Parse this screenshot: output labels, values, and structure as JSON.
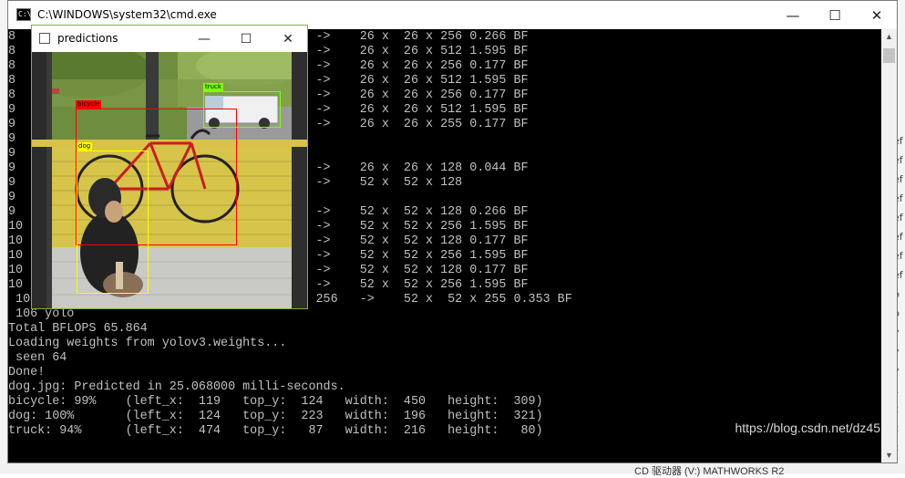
{
  "cmd_window": {
    "title": "C:\\WINDOWS\\system32\\cmd.exe",
    "icon_text": "C:\\",
    "minimize": "—",
    "maximize": "☐",
    "close": "✕"
  },
  "predictions_window": {
    "title": "predictions",
    "minimize": "—",
    "maximize": "☐",
    "close": "✕",
    "labels": {
      "bicycle": "bicycle",
      "truck": "truck",
      "dog": "dog"
    },
    "colors": {
      "bicycle": "#ff0000",
      "truck": "#80ff00",
      "dog": "#ffff00"
    }
  },
  "console": {
    "lines": [
      "8                                   768   ->    26 x  26 x 256 0.266 BF",
      "8                                   256   ->    26 x  26 x 512 1.595 BF",
      "8                                   512   ->    26 x  26 x 256 0.177 BF",
      "8                                   256   ->    26 x  26 x 512 1.595 BF",
      "8                                   512   ->    26 x  26 x 256 0.177 BF",
      "9                                   256   ->    26 x  26 x 512 1.595 BF",
      "9                                   512   ->    26 x  26 x 255 0.177 BF",
      "9",
      "9",
      "9                                   256   ->    26 x  26 x 128 0.044 BF",
      "9                                   128   ->    52 x  52 x 128",
      "9",
      "9                                   384   ->    52 x  52 x 128 0.266 BF",
      "10                                  128   ->    52 x  52 x 256 1.595 BF",
      "10                                  256   ->    52 x  52 x 128 0.177 BF",
      "10                                  128   ->    52 x  52 x 256 1.595 BF",
      "10                                  256   ->    52 x  52 x 128 0.177 BF",
      "10                                  128   ->    52 x  52 x 256 1.595 BF",
      " 105 conv    255  1 x 1 / 1    52 x  52 x 256   ->    52 x  52 x 255 0.353 BF",
      " 106 yolo",
      "Total BFLOPS 65.864",
      "Loading weights from yolov3.weights...",
      " seen 64",
      "Done!",
      "dog.jpg: Predicted in 25.068000 milli-seconds.",
      "bicycle: 99%    (left_x:  119   top_y:  124   width:  450   height:  309)",
      "dog: 100%       (left_x:  124   top_y:  223   width:  196   height:  321)",
      "truck: 94%      (left_x:  474   top_y:   87   width:  216   height:   80)"
    ]
  },
  "watermark": "https://blog.csdn.net/dz45",
  "background": {
    "right_edge": [
      "ef",
      "ef",
      "ef",
      "ef",
      "ef",
      "ef",
      "ef",
      "ef",
      "p",
      "p",
      "v",
      "v",
      "v",
      "l.",
      "c",
      "c",
      "c"
    ],
    "taskbar_text": "CD 驱动器 (V:) MATHWORKS R2"
  }
}
